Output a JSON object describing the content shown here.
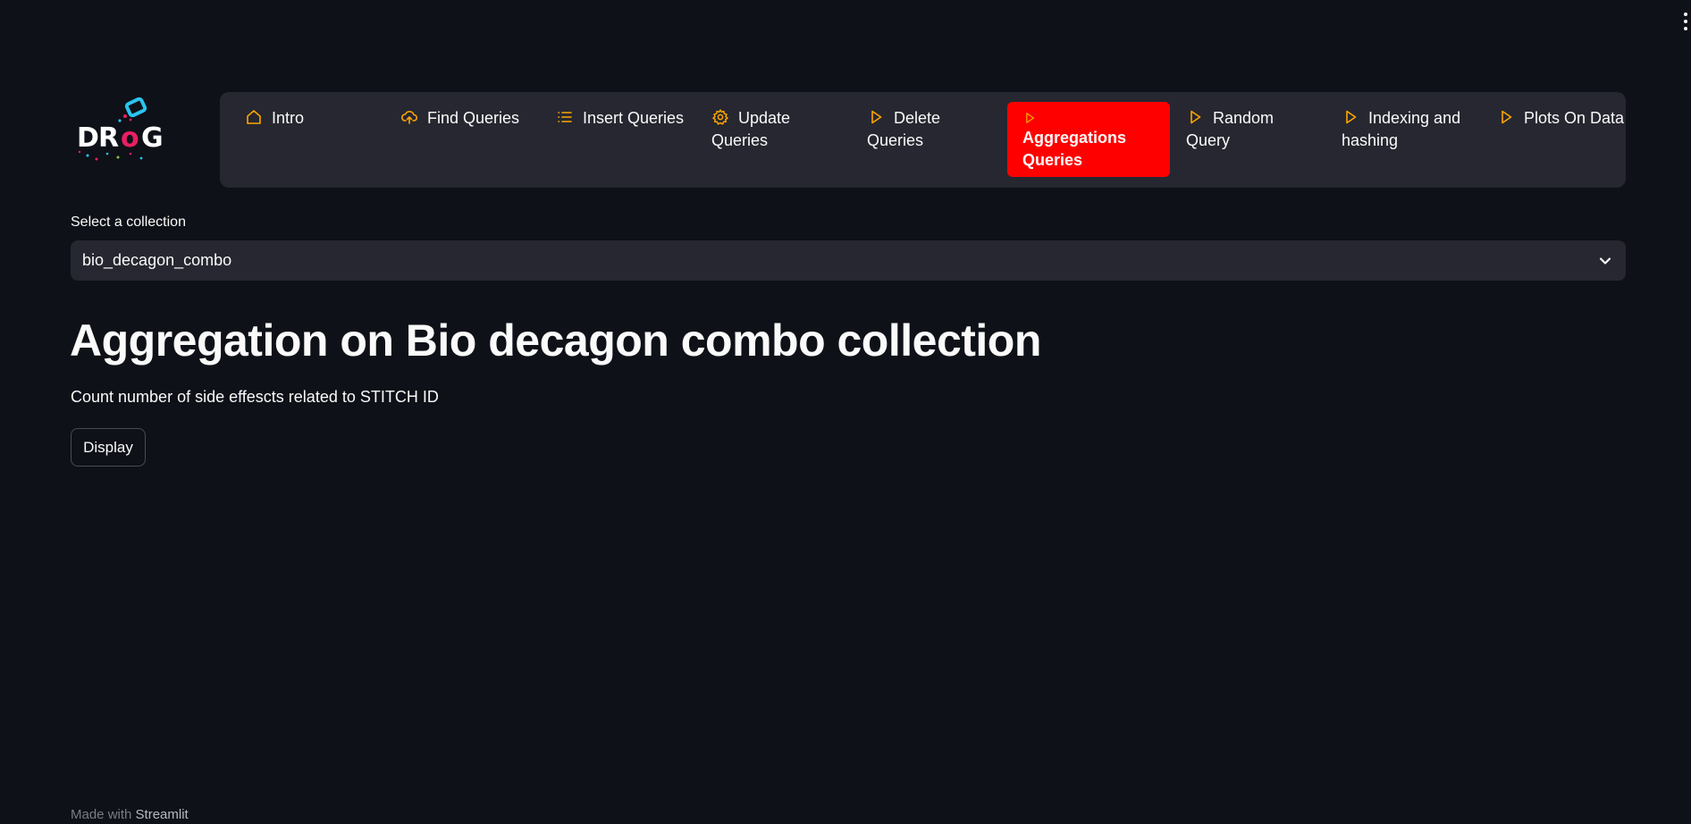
{
  "logo": {
    "text": "DRoG",
    "letters": [
      "D",
      "R",
      "o",
      "G"
    ]
  },
  "nav": {
    "items": [
      {
        "label": "Intro",
        "icon": "home-icon"
      },
      {
        "label": "Find Queries",
        "icon": "cloud-upload-icon"
      },
      {
        "label": "Insert Queries",
        "icon": "list-icon"
      },
      {
        "label": "Update Queries",
        "icon": "gear-icon"
      },
      {
        "label": "Delete Queries",
        "icon": "play-icon"
      },
      {
        "label": "Aggregations Queries",
        "icon": "play-icon",
        "active": true
      },
      {
        "label": "Random Query",
        "icon": "play-icon"
      },
      {
        "label": "Indexing and hashing",
        "icon": "play-icon"
      },
      {
        "label": "Plots On Data",
        "icon": "play-icon"
      }
    ]
  },
  "collection_select": {
    "label": "Select a collection",
    "value": "bio_decagon_combo"
  },
  "main": {
    "title": "Aggregation on Bio decagon combo collection",
    "description": "Count number of side effescts related to STITCH ID",
    "display_button": "Display"
  },
  "footer": {
    "prefix": "Made with",
    "brand": "Streamlit"
  },
  "colors": {
    "background": "#0e1117",
    "surface": "#262730",
    "accent_active": "#ff0000",
    "icon_orange": "#ffa500",
    "text": "#fafafa"
  }
}
